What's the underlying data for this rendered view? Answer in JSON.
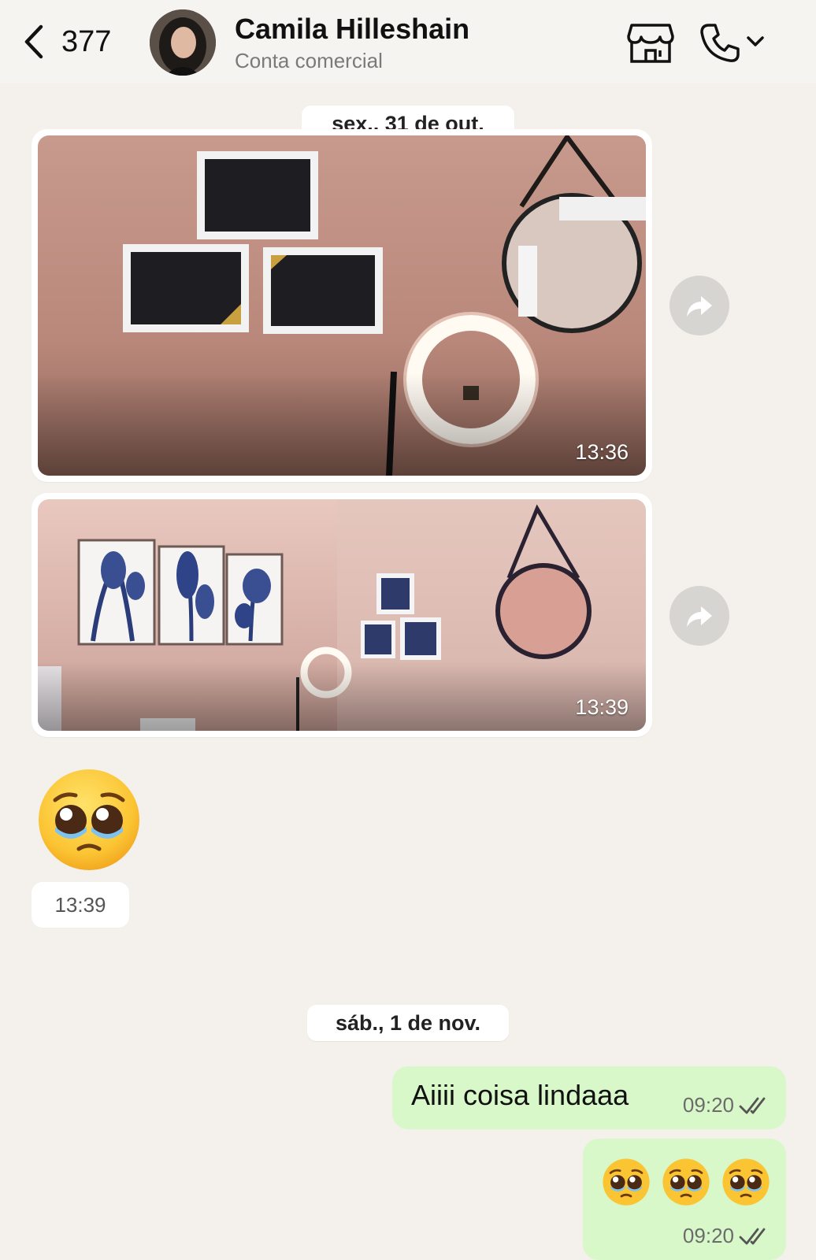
{
  "header": {
    "back_count": "377",
    "contact_name": "Camila Hilleshain",
    "contact_subtitle": "Conta comercial",
    "icons": [
      "chevron-left-icon",
      "storefront-icon",
      "phone-icon",
      "chevron-down-icon"
    ]
  },
  "conversation": {
    "date_1": "sex., 31 de out.",
    "date_2": "sáb., 1 de nov.",
    "incoming": [
      {
        "type": "photo",
        "time": "13:36"
      },
      {
        "type": "photo",
        "time": "13:39"
      },
      {
        "type": "emoji",
        "emoji": "🥹",
        "time": "13:39"
      }
    ],
    "outgoing": [
      {
        "text": "Aiiii coisa lindaaa",
        "time": "09:20",
        "status": "read"
      },
      {
        "emojis": "🥹 🥹 🥹",
        "time": "09:20",
        "status": "read"
      }
    ]
  },
  "colors": {
    "background": "#f4f1ec",
    "outgoing_bubble": "#d8f8c9",
    "incoming_bubble": "#ffffff",
    "wall_pink": "#c89a8c"
  }
}
